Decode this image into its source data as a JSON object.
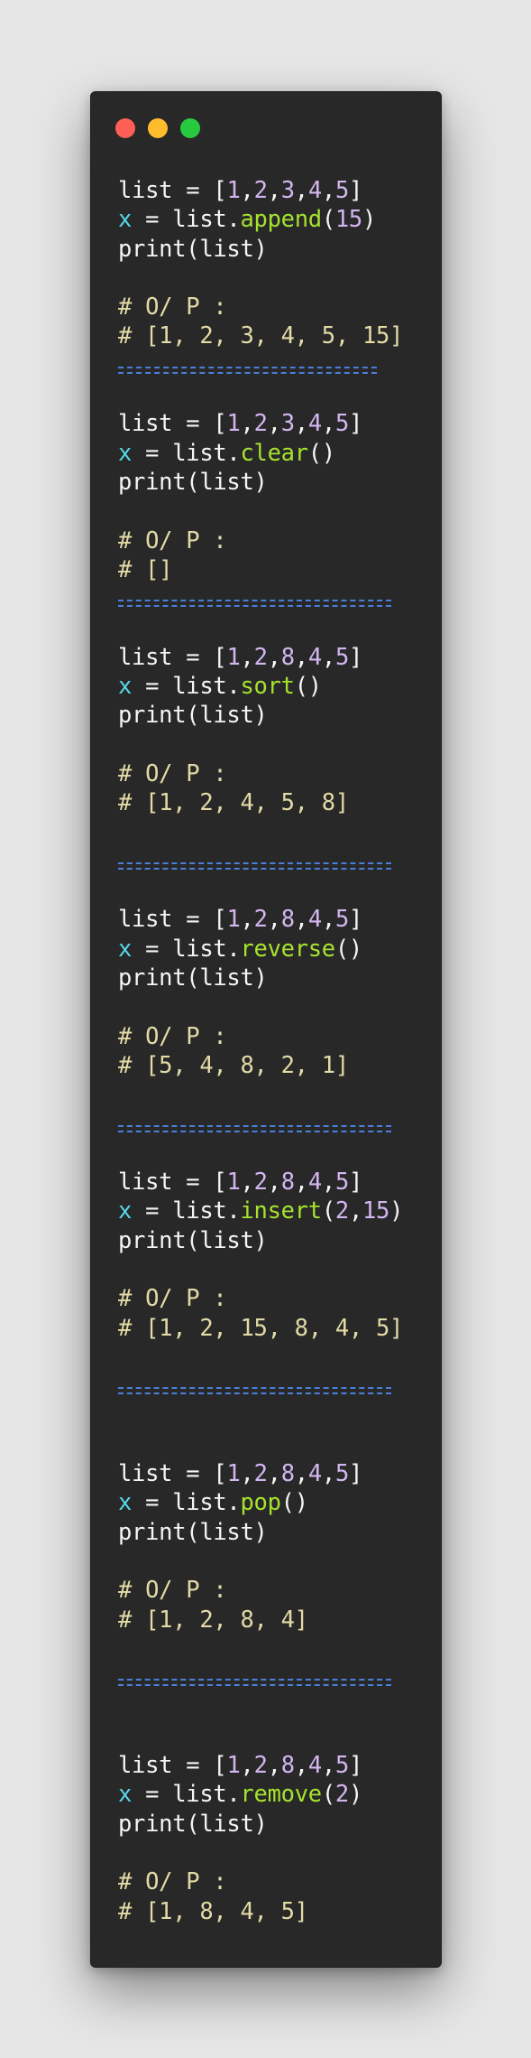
{
  "window": {
    "controls": {
      "close_color": "#ff5f56",
      "minimize_color": "#ffbd2e",
      "maximize_color": "#27c93f"
    }
  },
  "colors": {
    "background": "#282828",
    "variable_x": "#56d8e8",
    "number": "#d3b6f0",
    "method": "#a6e22e",
    "comment": "#e3dba6",
    "separator": "#4a7fd9"
  },
  "blocks": [
    {
      "list_kw": "list",
      "assign": " = ",
      "list_open": "[",
      "list_vals": [
        "1",
        "2",
        "3",
        "4",
        "5"
      ],
      "list_close": "]",
      "x_var": "x",
      "x_assign": " = list.",
      "method": "append",
      "call_open": "(",
      "args": [
        "15"
      ],
      "call_close": ")",
      "print_line": "print(list)",
      "output_label": "# O/ P :",
      "output_value": "# [1, 2, 3, 4, 5, 15]",
      "separator": "------------------"
    },
    {
      "list_kw": "list",
      "assign": " = ",
      "list_open": "[",
      "list_vals": [
        "1",
        "2",
        "3",
        "4",
        "5"
      ],
      "list_close": "]",
      "x_var": "x",
      "x_assign": " = list.",
      "method": "clear",
      "call_open": "(",
      "args": [],
      "call_close": ")",
      "print_line": "print(list)",
      "output_label": "# O/ P :",
      "output_value": "# []",
      "separator": "-------------------"
    },
    {
      "list_kw": "list",
      "assign": " = ",
      "list_open": "[",
      "list_vals": [
        "1",
        "2",
        "8",
        "4",
        "5"
      ],
      "list_close": "]",
      "x_var": "x",
      "x_assign": " = list.",
      "method": "sort",
      "call_open": "(",
      "args": [],
      "call_close": ")",
      "print_line": "print(list)",
      "output_label": "# O/ P :",
      "output_value": "# [1, 2, 4, 5, 8]",
      "separator": "-------------------"
    },
    {
      "list_kw": "list",
      "assign": " = ",
      "list_open": "[",
      "list_vals": [
        "1",
        "2",
        "8",
        "4",
        "5"
      ],
      "list_close": "]",
      "x_var": "x",
      "x_assign": " = list.",
      "method": "reverse",
      "call_open": "(",
      "args": [],
      "call_close": ")",
      "print_line": "print(list)",
      "output_label": "# O/ P :",
      "output_value": "# [5, 4, 8, 2, 1]",
      "separator": "-------------------"
    },
    {
      "list_kw": "list",
      "assign": " = ",
      "list_open": "[",
      "list_vals": [
        "1",
        "2",
        "8",
        "4",
        "5"
      ],
      "list_close": "]",
      "x_var": "x",
      "x_assign": " = list.",
      "method": "insert",
      "call_open": "(",
      "args": [
        "2",
        "15"
      ],
      "call_close": ")",
      "print_line": "print(list)",
      "output_label": "# O/ P :",
      "output_value": "# [1, 2, 15, 8, 4, 5]",
      "separator": "-------------------"
    },
    {
      "list_kw": "list",
      "assign": " = ",
      "list_open": "[",
      "list_vals": [
        "1",
        "2",
        "8",
        "4",
        "5"
      ],
      "list_close": "]",
      "x_var": "x",
      "x_assign": " = list.",
      "method": "pop",
      "call_open": "(",
      "args": [],
      "call_close": ")",
      "print_line": "print(list)",
      "output_label": "# O/ P :",
      "output_value": "# [1, 2, 8, 4]",
      "separator": "-------------------"
    },
    {
      "list_kw": "list",
      "assign": " = ",
      "list_open": "[",
      "list_vals": [
        "1",
        "2",
        "8",
        "4",
        "5"
      ],
      "list_close": "]",
      "x_var": "x",
      "x_assign": " = list.",
      "method": "remove",
      "call_open": "(",
      "args": [
        "2"
      ],
      "call_close": ")",
      "print_line": "print(list)",
      "output_label": "# O/ P :",
      "output_value": "# [1, 8, 4, 5]",
      "separator": ""
    }
  ]
}
